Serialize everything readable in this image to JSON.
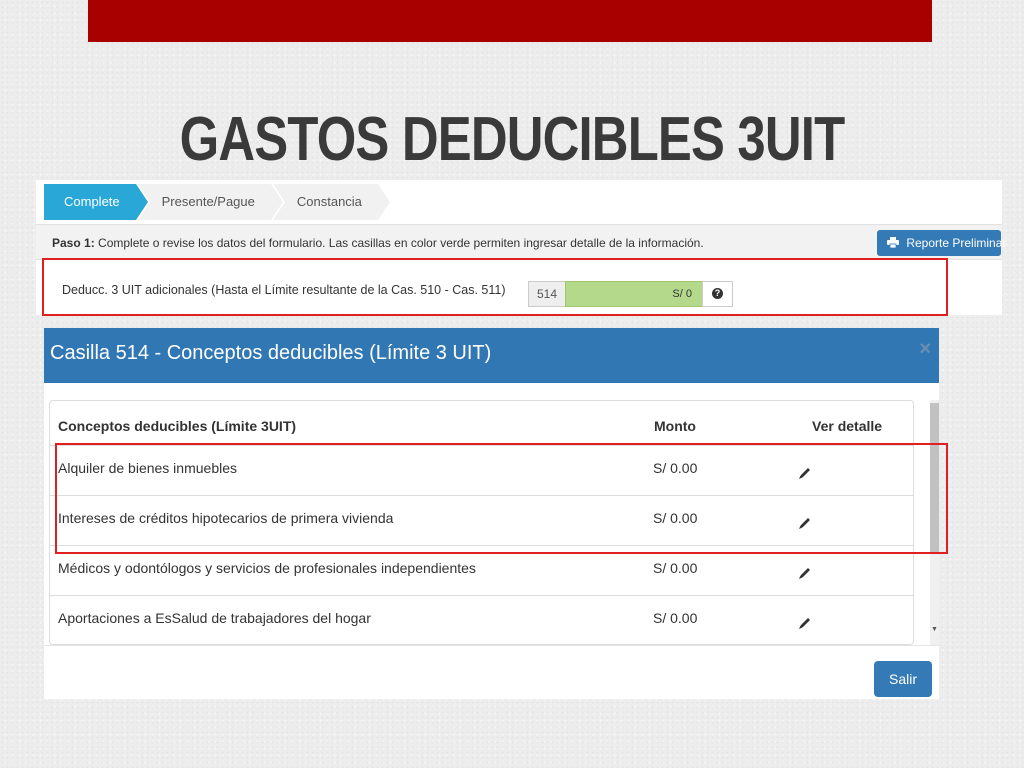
{
  "slide": {
    "title": "GASTOS DEDUCIBLES 3UIT"
  },
  "wizard": {
    "steps": [
      {
        "label": "Complete",
        "active": true
      },
      {
        "label": "Presente/Pague",
        "active": false
      },
      {
        "label": "Constancia",
        "active": false
      }
    ]
  },
  "instructions": {
    "step_label": "Paso 1:",
    "text": "Complete o revise los datos del formulario. Las casillas en color verde permiten ingresar detalle de la información."
  },
  "report_button": {
    "label": "Reporte Preliminar",
    "icon": "printer-icon"
  },
  "field": {
    "label": "Deducc. 3 UIT adicionales (Hasta el Límite resultante de la Cas. 510 - Cas. 511)",
    "casilla": "514",
    "value": "S/ 0",
    "help_icon": "question-circle-icon"
  },
  "modal": {
    "title": "Casilla 514 - Conceptos deducibles (Límite 3 UIT)",
    "close_label": "×",
    "headers": {
      "concept": "Conceptos deducibles (Límite 3UIT)",
      "amount": "Monto",
      "detail": "Ver detalle"
    },
    "rows": [
      {
        "concept": "Alquiler de bienes inmuebles",
        "amount": "S/ 0.00",
        "icon": "pencil-icon"
      },
      {
        "concept": "Intereses de créditos hipotecarios de primera vivienda",
        "amount": "S/ 0.00",
        "icon": "pencil-icon"
      },
      {
        "concept": "Médicos y odontólogos y servicios de profesionales independientes",
        "amount": "S/ 0.00",
        "icon": "pencil-icon"
      },
      {
        "concept": "Aportaciones a EsSalud de trabajadores del hogar",
        "amount": "S/ 0.00",
        "icon": "pencil-icon"
      }
    ],
    "exit_label": "Salir"
  },
  "colors": {
    "title_bar": "#a80000",
    "wizard_active": "#29a8d8",
    "primary": "#337ab7",
    "modal_header": "#3077b4",
    "green_field": "#b5d98a",
    "highlight": "#e02020"
  }
}
